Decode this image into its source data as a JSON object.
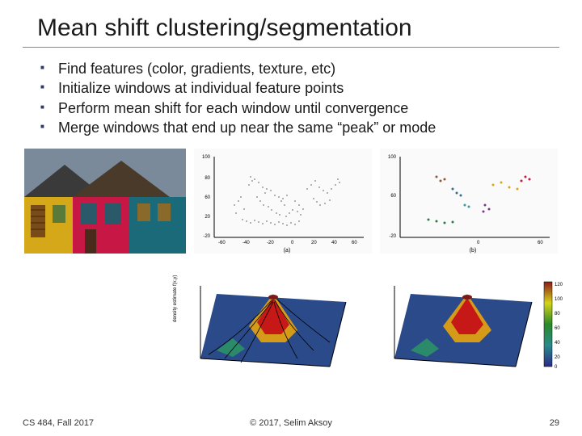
{
  "title": "Mean shift clustering/segmentation",
  "bullets": [
    "Find features (color, gradients, texture, etc)",
    "Initialize windows at individual feature points",
    "Perform mean shift for each window until convergence",
    "Merge windows that end up near the same “peak” or mode"
  ],
  "scatter_bw": {
    "xlabel_a": "(a)"
  },
  "scatter_color": {
    "xlabel_b": "(b)"
  },
  "footer": {
    "left": "CS 484, Fall 2017",
    "center": "© 2017, Selim Aksoy",
    "right": "29"
  }
}
